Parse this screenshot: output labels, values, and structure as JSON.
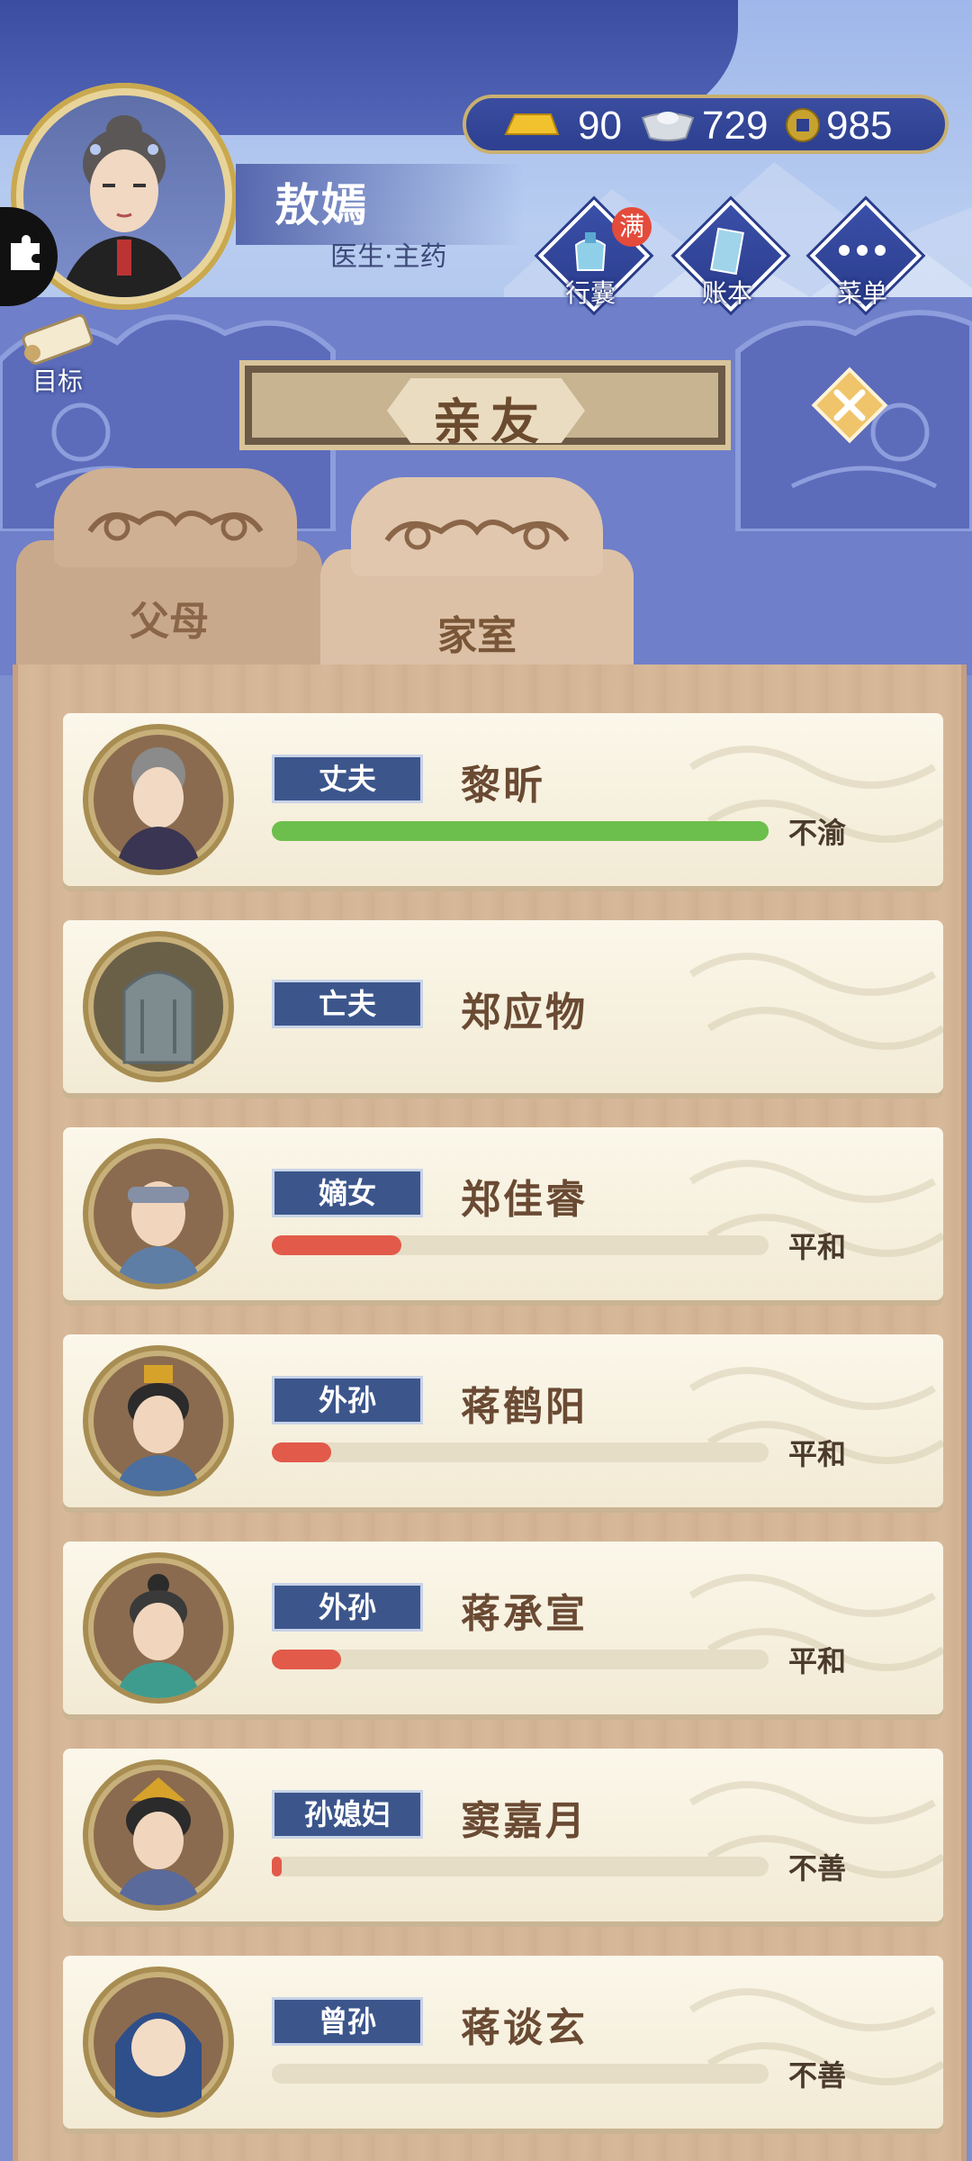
{
  "player": {
    "name": "敖嫣",
    "title": "医生·主药",
    "goal_label": "目标"
  },
  "currency": {
    "gold": "90",
    "silver": "729",
    "copper": "985"
  },
  "top_buttons": [
    {
      "label": "行囊",
      "badge": "满"
    },
    {
      "label": "账本"
    },
    {
      "label": "菜单"
    }
  ],
  "screen_title": "亲友",
  "tabs": [
    {
      "label": "父母",
      "active": false
    },
    {
      "label": "家室",
      "active": true
    }
  ],
  "relatives": [
    {
      "role": "丈夫",
      "name": "黎昕",
      "mood": "不渝",
      "affinity": 1.0,
      "bar_color": "#6cbf4c",
      "avatar": "grey-bun-woman"
    },
    {
      "role": "亡夫",
      "name": "郑应物",
      "mood": "",
      "affinity": null,
      "bar_color": "",
      "avatar": "gravestone"
    },
    {
      "role": "嫡女",
      "name": "郑佳睿",
      "mood": "平和",
      "affinity": 0.26,
      "bar_color": "#e25a4a",
      "avatar": "headband-woman"
    },
    {
      "role": "外孙",
      "name": "蒋鹤阳",
      "mood": "平和",
      "affinity": 0.12,
      "bar_color": "#e25a4a",
      "avatar": "scholar-man"
    },
    {
      "role": "外孙",
      "name": "蒋承宣",
      "mood": "平和",
      "affinity": 0.14,
      "bar_color": "#e25a4a",
      "avatar": "topknot-man"
    },
    {
      "role": "孙媳妇",
      "name": "窦嘉月",
      "mood": "不善",
      "affinity": 0.02,
      "bar_color": "#e25a4a",
      "avatar": "crowned-woman"
    },
    {
      "role": "曾孙",
      "name": "蒋谈玄",
      "mood": "不善",
      "affinity": 0.0,
      "bar_color": "#e25a4a",
      "avatar": "hooded-child"
    }
  ]
}
